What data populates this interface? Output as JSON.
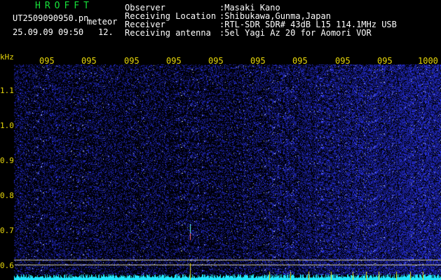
{
  "header": {
    "title": "HROFFT",
    "filename": "UT2509090950.pn",
    "tag": "meteor",
    "datetime": "25.09.09 09:50",
    "count": "12.",
    "fields": [
      {
        "label": "Observer",
        "value": ":Masaki Kano"
      },
      {
        "label": "Receiving Location",
        "value": ":Shibukawa,Gunma,Japan"
      },
      {
        "label": "Receiver",
        "value": ":RTL-SDR SDR# 43dB L15 114.1MHz USB"
      },
      {
        "label": "Receiving antenna",
        "value": ":5el Yagi Az 20 for Aomori VOR"
      }
    ]
  },
  "time_axis": {
    "ticks": [
      "095",
      "095",
      "095",
      "095",
      "095",
      "095",
      "095",
      "095",
      "095",
      "1000"
    ]
  },
  "freq_axis": {
    "unit": "kHz",
    "ticks": [
      "1.1",
      "1.0",
      "0.9",
      "0.8",
      "0.7",
      "0.6"
    ]
  },
  "colors": {
    "background": "#000000",
    "header_text": "#ffffff",
    "title": "#17e03a",
    "axis_text": "#e7d70a",
    "noise": "#2a3aff",
    "baseline": "#22e8ff"
  }
}
